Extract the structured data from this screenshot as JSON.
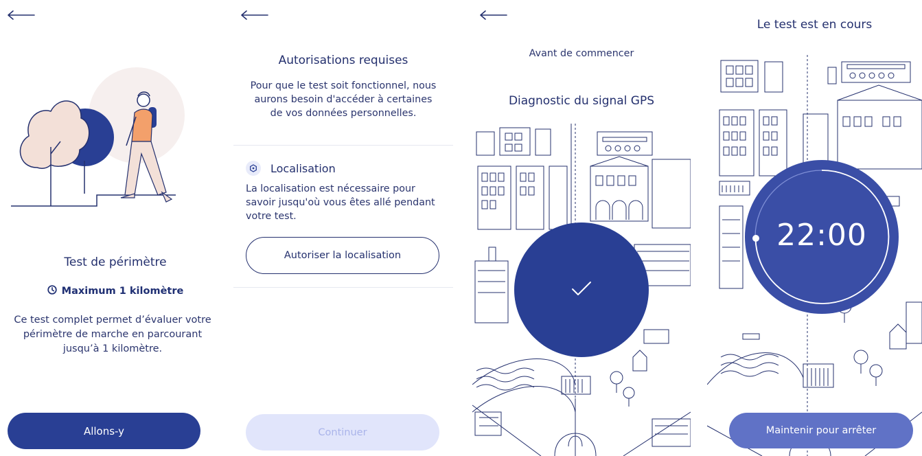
{
  "colors": {
    "primary": "#293f94",
    "text": "#24306e",
    "disabled_bg": "#e1e5fb",
    "disabled_text": "#aab4ea",
    "stop_button": "#6072c6"
  },
  "screen_intro": {
    "back_icon": "arrow-left-icon",
    "title": "Test de périmètre",
    "max_distance": "Maximum 1 kilomètre",
    "max_icon": "clock-icon",
    "description": "Ce test complet permet d’évaluer votre périmètre de marche en parcourant jusqu’à 1 kilomètre.",
    "cta": "Allons-y"
  },
  "screen_permissions": {
    "back_icon": "arrow-left-icon",
    "title": "Autorisations requises",
    "description": "Pour que le test soit fonctionnel, nous aurons besoin d'accéder à certaines de vos données personnelles.",
    "permission_title": "Localisation",
    "permission_icon": "location-icon",
    "permission_description": "La localisation est nécessaire pour savoir jusqu'où vous êtes allé pendant votre test.",
    "authorize_button": "Autoriser la localisation",
    "continue_button": "Continuer"
  },
  "screen_gps": {
    "back_icon": "arrow-left-icon",
    "pre_title": "Avant de commencer",
    "title": "Diagnostic du signal GPS",
    "status_icon": "checkmark-icon"
  },
  "screen_running": {
    "title": "Le test est en cours",
    "timer": "22:00",
    "stop_button": "Maintenir pour arrêter"
  }
}
